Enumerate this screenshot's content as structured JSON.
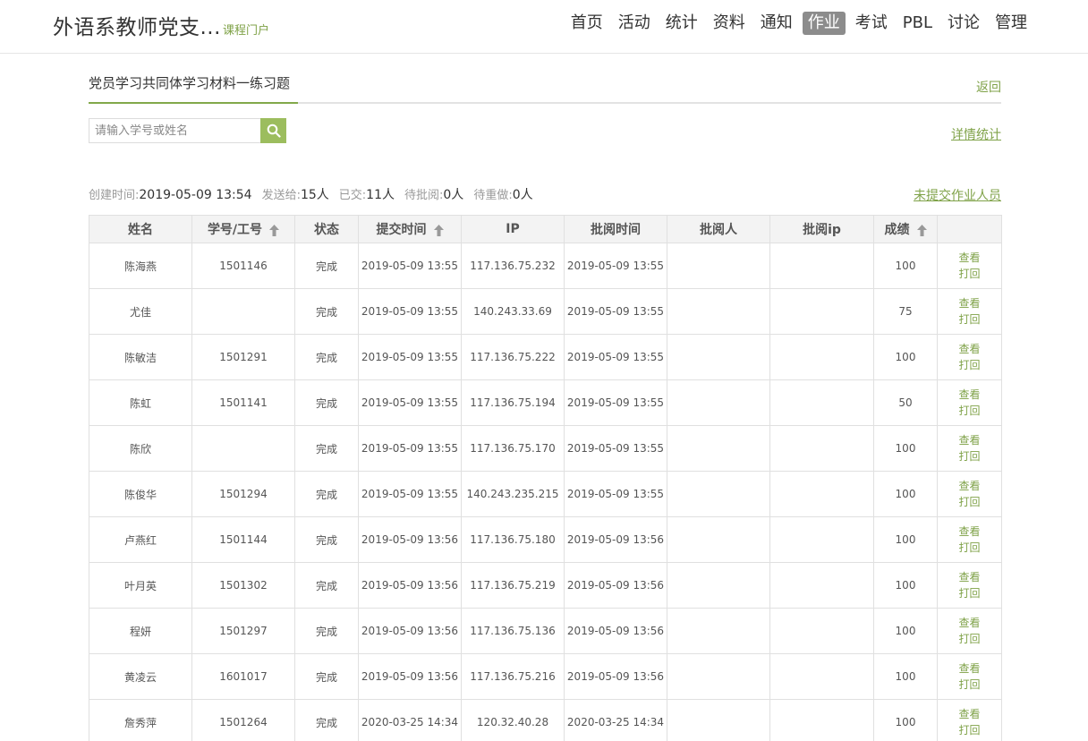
{
  "header": {
    "title": "外语系教师党支...",
    "subtitle": "课程门户",
    "nav": [
      "首页",
      "活动",
      "统计",
      "资料",
      "通知",
      "作业",
      "考试",
      "PBL",
      "讨论",
      "管理"
    ],
    "active_index": 5
  },
  "tab": {
    "title": "党员学习共同体学习材料一练习题",
    "back": "返回"
  },
  "search": {
    "placeholder": "请输入学号或姓名",
    "value": ""
  },
  "detail_link": "详情统计",
  "info": {
    "created_label": "创建时间:",
    "created_value": "2019-05-09 13:54",
    "sent_label": "发送给:",
    "sent_value": "15人",
    "submitted_label": "已交:",
    "submitted_value": "11人",
    "pending_label": "待批阅:",
    "pending_value": "0人",
    "redo_label": "待重做:",
    "redo_value": "0人"
  },
  "unsubmitted_link": "未提交作业人员",
  "table": {
    "columns": [
      "姓名",
      "学号/工号",
      "状态",
      "提交时间",
      "IP",
      "批阅时间",
      "批阅人",
      "批阅ip",
      "成绩",
      ""
    ],
    "sortable": [
      false,
      true,
      false,
      true,
      false,
      false,
      false,
      false,
      true,
      false
    ],
    "action_view": "查看",
    "action_print": "打回",
    "rows": [
      {
        "name": "陈海燕",
        "id": "1501146",
        "status": "完成",
        "submit_time": "2019-05-09 13:55",
        "ip": "117.136.75.232",
        "review_time": "2019-05-09 13:55",
        "reviewer": "",
        "review_ip": "",
        "score": "100"
      },
      {
        "name": "尤佳",
        "id": "",
        "status": "完成",
        "submit_time": "2019-05-09 13:55",
        "ip": "140.243.33.69",
        "review_time": "2019-05-09 13:55",
        "reviewer": "",
        "review_ip": "",
        "score": "75"
      },
      {
        "name": "陈敏洁",
        "id": "1501291",
        "status": "完成",
        "submit_time": "2019-05-09 13:55",
        "ip": "117.136.75.222",
        "review_time": "2019-05-09 13:55",
        "reviewer": "",
        "review_ip": "",
        "score": "100"
      },
      {
        "name": "陈虹",
        "id": "1501141",
        "status": "完成",
        "submit_time": "2019-05-09 13:55",
        "ip": "117.136.75.194",
        "review_time": "2019-05-09 13:55",
        "reviewer": "",
        "review_ip": "",
        "score": "50"
      },
      {
        "name": "陈欣",
        "id": "",
        "status": "完成",
        "submit_time": "2019-05-09 13:55",
        "ip": "117.136.75.170",
        "review_time": "2019-05-09 13:55",
        "reviewer": "",
        "review_ip": "",
        "score": "100"
      },
      {
        "name": "陈俊华",
        "id": "1501294",
        "status": "完成",
        "submit_time": "2019-05-09 13:55",
        "ip": "140.243.235.215",
        "review_time": "2019-05-09 13:55",
        "reviewer": "",
        "review_ip": "",
        "score": "100"
      },
      {
        "name": "卢燕红",
        "id": "1501144",
        "status": "完成",
        "submit_time": "2019-05-09 13:56",
        "ip": "117.136.75.180",
        "review_time": "2019-05-09 13:56",
        "reviewer": "",
        "review_ip": "",
        "score": "100"
      },
      {
        "name": "叶月英",
        "id": "1501302",
        "status": "完成",
        "submit_time": "2019-05-09 13:56",
        "ip": "117.136.75.219",
        "review_time": "2019-05-09 13:56",
        "reviewer": "",
        "review_ip": "",
        "score": "100"
      },
      {
        "name": "程妍",
        "id": "1501297",
        "status": "完成",
        "submit_time": "2019-05-09 13:56",
        "ip": "117.136.75.136",
        "review_time": "2019-05-09 13:56",
        "reviewer": "",
        "review_ip": "",
        "score": "100"
      },
      {
        "name": "黄凌云",
        "id": "1601017",
        "status": "完成",
        "submit_time": "2019-05-09 13:56",
        "ip": "117.136.75.216",
        "review_time": "2019-05-09 13:56",
        "reviewer": "",
        "review_ip": "",
        "score": "100"
      },
      {
        "name": "詹秀萍",
        "id": "1501264",
        "status": "完成",
        "submit_time": "2020-03-25 14:34",
        "ip": "120.32.40.28",
        "review_time": "2020-03-25 14:34",
        "reviewer": "",
        "review_ip": "",
        "score": "100"
      }
    ]
  }
}
